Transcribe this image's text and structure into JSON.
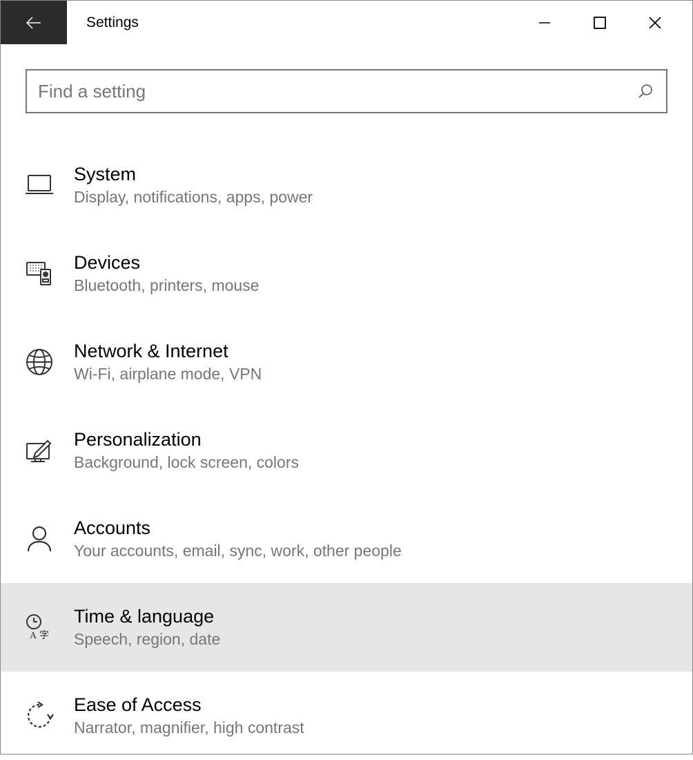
{
  "window": {
    "title": "Settings"
  },
  "search": {
    "placeholder": "Find a setting",
    "value": ""
  },
  "categories": [
    {
      "id": "system",
      "icon": "laptop-icon",
      "title": "System",
      "description": "Display, notifications, apps, power",
      "hovered": false
    },
    {
      "id": "devices",
      "icon": "devices-icon",
      "title": "Devices",
      "description": "Bluetooth, printers, mouse",
      "hovered": false
    },
    {
      "id": "network",
      "icon": "globe-icon",
      "title": "Network & Internet",
      "description": "Wi-Fi, airplane mode, VPN",
      "hovered": false
    },
    {
      "id": "personalization",
      "icon": "personalization-icon",
      "title": "Personalization",
      "description": "Background, lock screen, colors",
      "hovered": false
    },
    {
      "id": "accounts",
      "icon": "person-icon",
      "title": "Accounts",
      "description": "Your accounts, email, sync, work, other people",
      "hovered": false
    },
    {
      "id": "time-language",
      "icon": "time-language-icon",
      "title": "Time & language",
      "description": "Speech, region, date",
      "hovered": true
    },
    {
      "id": "ease-of-access",
      "icon": "ease-of-access-icon",
      "title": "Ease of Access",
      "description": "Narrator, magnifier, high contrast",
      "hovered": false
    }
  ]
}
